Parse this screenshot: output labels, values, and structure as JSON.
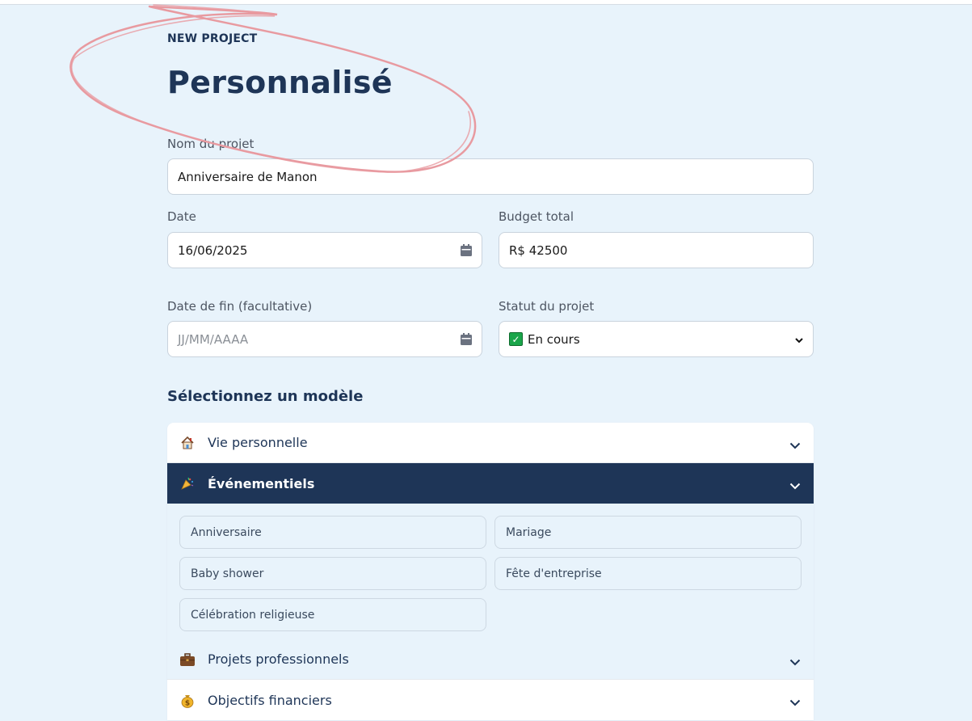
{
  "header": {
    "eyebrow": "NEW PROJECT",
    "title": "Personnalisé"
  },
  "form": {
    "name": {
      "label": "Nom du projet",
      "value": "Anniversaire de Manon"
    },
    "date": {
      "label": "Date",
      "value": "16/06/2025"
    },
    "budget": {
      "label": "Budget total",
      "value": "R$ 42500"
    },
    "end_date": {
      "label": "Date de fin (facultative)",
      "placeholder": "JJ/MM/AAAA"
    },
    "status": {
      "label": "Statut du projet",
      "value": "En cours",
      "icon": "check-mark-emoji"
    }
  },
  "templates": {
    "title": "Sélectionnez un modèle",
    "categories": [
      {
        "label": "Vie personnelle",
        "icon": "house-icon",
        "expanded": false
      },
      {
        "label": "Événementiels",
        "icon": "party-popper-icon",
        "expanded": true,
        "items": [
          "Anniversaire",
          "Mariage",
          "Baby shower",
          "Fête d'entreprise",
          "Célébration religieuse"
        ]
      },
      {
        "label": "Projets professionnels",
        "icon": "briefcase-icon",
        "expanded": false
      },
      {
        "label": "Objectifs financiers",
        "icon": "money-bag-icon",
        "expanded": false
      }
    ]
  },
  "colors": {
    "background": "#e8f3fb",
    "primary": "#1e3557",
    "annotation": "#e89aa0"
  }
}
